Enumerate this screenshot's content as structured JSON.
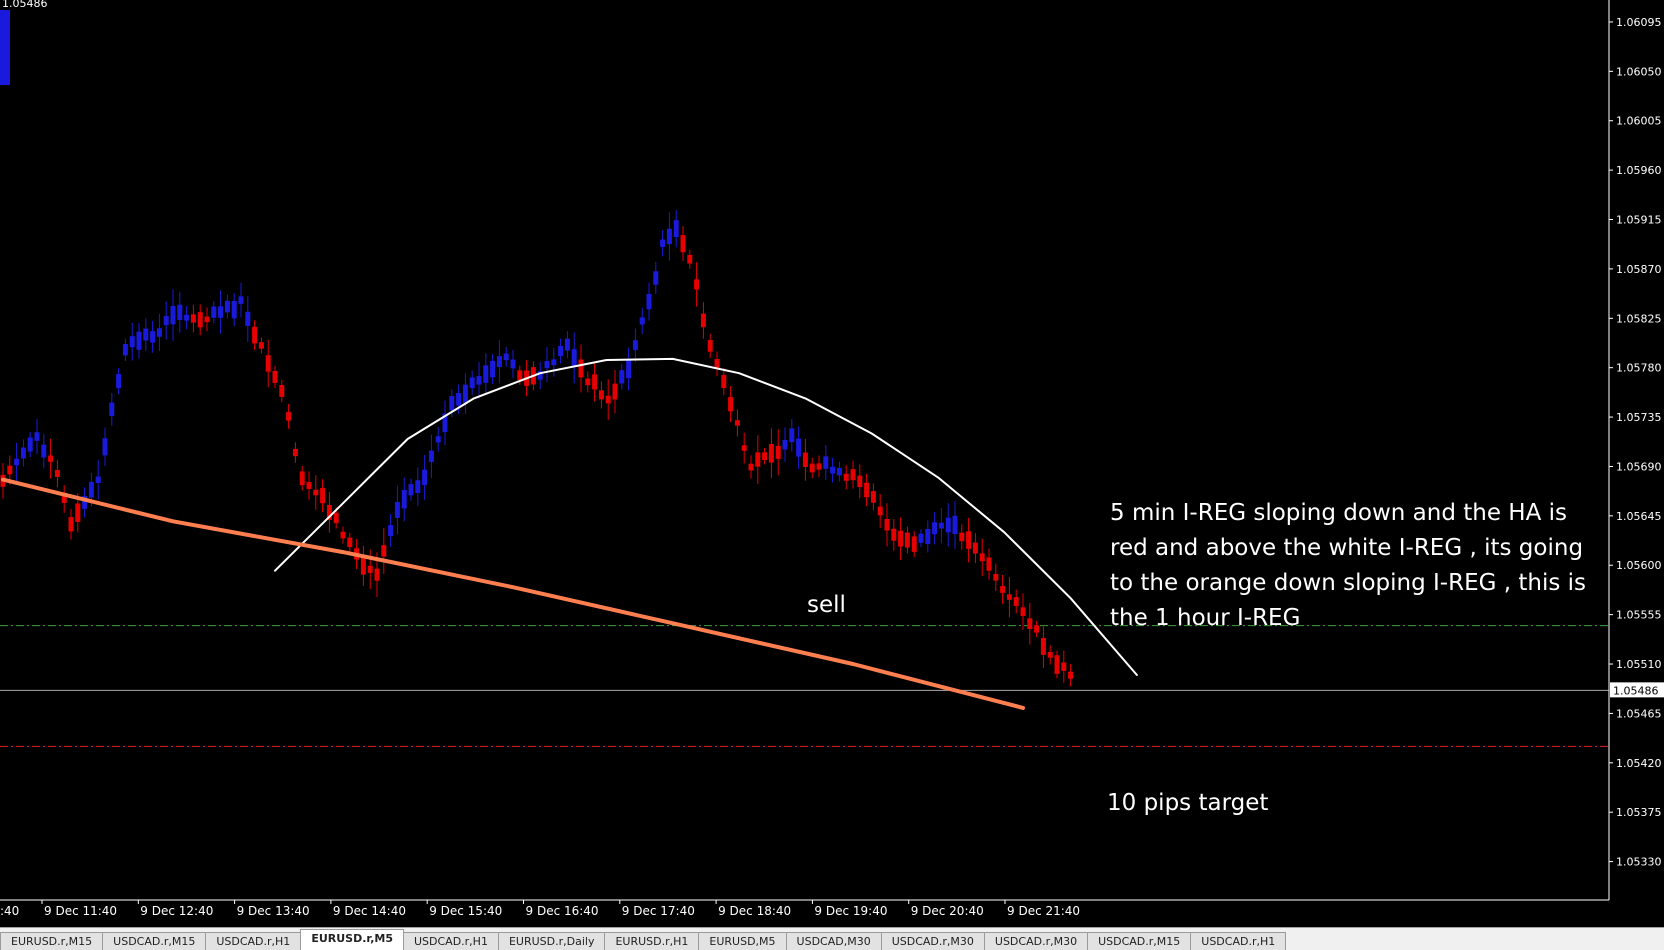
{
  "window": {
    "header_price": "1.05486"
  },
  "chart_data": {
    "type": "candlestick",
    "symbol": "EURUSD.r",
    "timeframe": "M5",
    "price_scale": {
      "ymin": 1.05295,
      "ymax": 1.06115,
      "tick_values": [
        1.06095,
        1.0605,
        1.06005,
        1.0596,
        1.05915,
        1.0587,
        1.05825,
        1.0578,
        1.05735,
        1.0569,
        1.05645,
        1.056,
        1.05555,
        1.0551,
        1.05465,
        1.0542,
        1.05375,
        1.0533
      ],
      "tick_labels": [
        "1.06095",
        "1.06050",
        "1.06005",
        "1.05960",
        "1.05915",
        "1.05870",
        "1.05825",
        "1.05780",
        "1.05735",
        "1.05690",
        "1.05645",
        "1.05600",
        "1.05555",
        "1.05510",
        "1.05465",
        "1.05420",
        "1.05375",
        "1.05330"
      ]
    },
    "current_price": 1.05486,
    "current_price_label": "1.05486",
    "time_axis": {
      "partial_left_label": ":40",
      "labels": [
        "9 Dec 11:40",
        "9 Dec 12:40",
        "9 Dec 13:40",
        "9 Dec 14:40",
        "9 Dec 15:40",
        "9 Dec 16:40",
        "9 Dec 17:40",
        "9 Dec 18:40",
        "9 Dec 19:40",
        "9 Dec 20:40",
        "9 Dec 21:40"
      ]
    },
    "anchors": [
      [
        0,
        1.0568,
        "down"
      ],
      [
        3,
        1.057,
        "up"
      ],
      [
        5,
        1.0572,
        "up"
      ],
      [
        8,
        1.0568,
        "down"
      ],
      [
        10,
        1.0564,
        "down"
      ],
      [
        14,
        1.0568,
        "up"
      ],
      [
        18,
        1.058,
        "up"
      ],
      [
        22,
        1.0581,
        "up"
      ],
      [
        26,
        1.0583,
        "up"
      ],
      [
        29,
        1.0582,
        "down"
      ],
      [
        32,
        1.0583,
        "up"
      ],
      [
        35,
        1.0584,
        "up"
      ],
      [
        38,
        1.058,
        "down"
      ],
      [
        41,
        1.0576,
        "down"
      ],
      [
        44,
        1.0568,
        "down"
      ],
      [
        47,
        1.0566,
        "down"
      ],
      [
        50,
        1.0563,
        "down"
      ],
      [
        53,
        1.056,
        "down"
      ],
      [
        55,
        1.0559,
        "down"
      ],
      [
        58,
        1.0565,
        "up"
      ],
      [
        62,
        1.0568,
        "up"
      ],
      [
        66,
        1.0575,
        "up"
      ],
      [
        70,
        1.0577,
        "up"
      ],
      [
        74,
        1.0579,
        "up"
      ],
      [
        77,
        1.0577,
        "down"
      ],
      [
        80,
        1.0578,
        "up"
      ],
      [
        83,
        1.058,
        "up"
      ],
      [
        86,
        1.0577,
        "down"
      ],
      [
        89,
        1.0575,
        "down"
      ],
      [
        92,
        1.0578,
        "up"
      ],
      [
        95,
        1.0584,
        "up"
      ],
      [
        97,
        1.0589,
        "up"
      ],
      [
        99,
        1.0591,
        "up"
      ],
      [
        101,
        1.0588,
        "down"
      ],
      [
        104,
        1.058,
        "down"
      ],
      [
        107,
        1.0575,
        "down"
      ],
      [
        110,
        1.0569,
        "down"
      ],
      [
        113,
        1.057,
        "down"
      ],
      [
        116,
        1.0572,
        "up"
      ],
      [
        119,
        1.0569,
        "down"
      ],
      [
        122,
        1.0569,
        "up"
      ],
      [
        125,
        1.0568,
        "down"
      ],
      [
        128,
        1.0566,
        "down"
      ],
      [
        131,
        1.0563,
        "down"
      ],
      [
        134,
        1.0562,
        "down"
      ],
      [
        136,
        1.0563,
        "up"
      ],
      [
        139,
        1.0564,
        "up"
      ],
      [
        142,
        1.0562,
        "down"
      ],
      [
        145,
        1.056,
        "down"
      ],
      [
        148,
        1.0557,
        "down"
      ],
      [
        151,
        1.0555,
        "down"
      ],
      [
        154,
        1.0552,
        "down"
      ],
      [
        157,
        1.055,
        "down"
      ]
    ],
    "indicators": [
      {
        "type": "regression_curve",
        "color": "#ffffff",
        "points": [
          [
            0,
            1.05595
          ],
          [
            5,
            1.05655
          ],
          [
            10,
            1.05715
          ],
          [
            15,
            1.05752
          ],
          [
            20,
            1.05775
          ],
          [
            25,
            1.05787
          ],
          [
            30,
            1.05788
          ],
          [
            35,
            1.05775
          ],
          [
            40,
            1.05752
          ],
          [
            45,
            1.0572
          ],
          [
            50,
            1.0568
          ],
          [
            55,
            1.0563
          ],
          [
            60,
            1.0557
          ],
          [
            65,
            1.055
          ]
        ]
      },
      {
        "type": "regression_curve",
        "color": "#ff7f50",
        "points": [
          [
            0,
            1.05678
          ],
          [
            20,
            1.0564
          ],
          [
            40,
            1.05612
          ],
          [
            60,
            1.0558
          ],
          [
            80,
            1.05545
          ],
          [
            100,
            1.0551
          ],
          [
            120,
            1.0547
          ]
        ]
      }
    ],
    "levels": [
      {
        "price": 1.05545,
        "color": "#3f9f3f",
        "style": "dash-dot"
      },
      {
        "price": 1.05435,
        "color": "#e02020",
        "style": "dash-dot"
      }
    ],
    "annotations": [
      {
        "text": "5 min I-REG sloping down and the HA is",
        "line": 0
      },
      {
        "text": "red and above the white I-REG , its going",
        "line": 1
      },
      {
        "text": "to the orange down sloping I-REG , this is",
        "line": 2
      },
      {
        "text": "the 1 hour I-REG",
        "line": 3
      },
      {
        "text": "sell"
      },
      {
        "text": "10 pips target"
      }
    ],
    "colors": {
      "bull": "#1a1adc",
      "bear": "#e60000",
      "background": "#000000",
      "axis": "#ffffff"
    }
  },
  "tabs": [
    {
      "label": "EURUSD.r,M15",
      "active": false
    },
    {
      "label": "USDCAD.r,M15",
      "active": false
    },
    {
      "label": "USDCAD.r,H1",
      "active": false
    },
    {
      "label": "EURUSD.r,M5",
      "active": true
    },
    {
      "label": "USDCAD.r,H1",
      "active": false
    },
    {
      "label": "EURUSD.r,Daily",
      "active": false
    },
    {
      "label": "EURUSD.r,H1",
      "active": false
    },
    {
      "label": "EURUSD,M5",
      "active": false
    },
    {
      "label": "USDCAD,M30",
      "active": false
    },
    {
      "label": "USDCAD.r,M30",
      "active": false
    },
    {
      "label": "USDCAD.r,M30",
      "active": false
    },
    {
      "label": "USDCAD.r,M15",
      "active": false
    },
    {
      "label": "USDCAD.r,H1",
      "active": false
    }
  ]
}
